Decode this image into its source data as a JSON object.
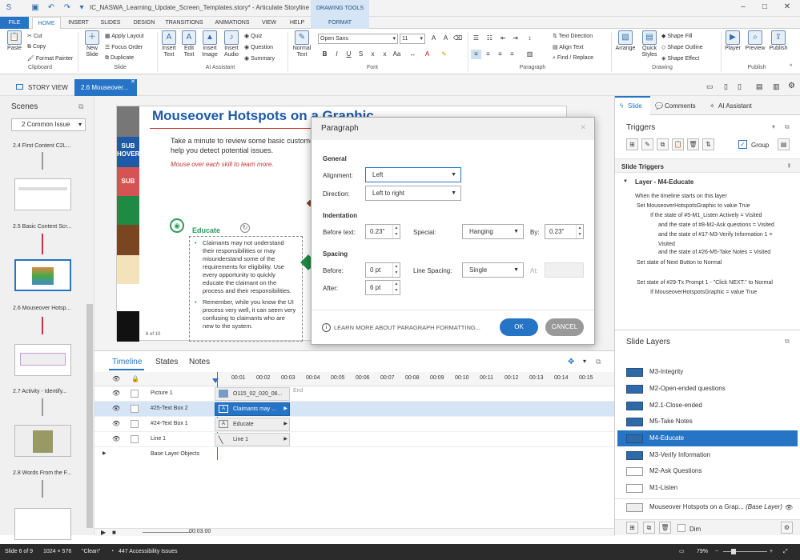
{
  "title": "IC_NASWA_Learning_Update_Screen_Templates.story* - Articulate Storyline x64",
  "contextual_tab": "DRAWING TOOLS",
  "tabs": [
    "FILE",
    "HOME",
    "INSERT",
    "SLIDES",
    "DESIGN",
    "TRANSITIONS",
    "ANIMATIONS",
    "VIEW",
    "HELP",
    "FORMAT"
  ],
  "ribbon": {
    "paste": "Paste",
    "cut": "Cut",
    "copy": "Copy",
    "format_painter": "Format Painter",
    "clipboard": "Clipboard",
    "new_slide": "New Slide",
    "apply_layout": "Apply Layout",
    "focus_order": "Focus Order",
    "duplicate": "Duplicate",
    "slide_group": "Slide",
    "insert_text": "Insert Text",
    "edit_text": "Edit Text",
    "insert_image": "Insert Image",
    "insert_audio": "Insert Audio",
    "quiz": "Quiz",
    "question": "Question",
    "summary": "Summary",
    "ai_assistant": "AI Assistant",
    "normal_text": "Normal Text",
    "font_name": "Open Sans",
    "font_size": "11",
    "font_group": "Font",
    "text_direction": "Text Direction",
    "align_text": "Align Text",
    "find_replace": "Find / Replace",
    "paragraph_group": "Paragraph",
    "arrange": "Arrange",
    "quick_styles": "Quick Styles",
    "shape_fill": "Shape Fill",
    "shape_outline": "Shape Outline",
    "shape_effect": "Shape Effect",
    "drawing_group": "Drawing",
    "player": "Player",
    "preview": "Preview",
    "publish": "Publish",
    "publish_group": "Publish"
  },
  "doc_tabs": {
    "story_view": "STORY VIEW",
    "current": "2.6 Mouseover..."
  },
  "scenes": {
    "title": "Scenes",
    "dropdown": "2 Common Issue",
    "labels": [
      "2.4 First Content C2L...",
      "2.5 Basic Content Scr...",
      "2.6 Mouseover Hotsp...",
      "2.7 Activity - Identify...",
      "2.8 Words From the F..."
    ]
  },
  "slide": {
    "heading": "Mouseover Hotspots on a Graphic",
    "intro": "Take a minute to review some basic customer",
    "intro2": "help you detect potential issues.",
    "instruction": "Mouse over each skill to learn more.",
    "sub1": "SUB",
    "hover": "HOVER",
    "sub2": "SUB",
    "educate": "Educate",
    "footer": "6 of 10",
    "bullets": [
      "Claimants may not understand their responsibilities or may misunderstand some of the requirements for eligibility. Use every opportunity to quickly educate the claimant on the process and their responsibilities.",
      "Remember, while you know the UI process very well, it can seem very confusing to claimants who are new to the system."
    ]
  },
  "dialog": {
    "title": "Paragraph",
    "general": "General",
    "alignment_label": "Alignment:",
    "alignment": "Left",
    "direction_label": "Direction:",
    "direction": "Left to right",
    "indentation": "Indentation",
    "before_text_label": "Before text:",
    "before_text": "0.23\"",
    "special_label": "Special:",
    "special": "Hanging",
    "by_label": "By:",
    "by": "0.23\"",
    "spacing": "Spacing",
    "before_label": "Before:",
    "before": "0 pt",
    "line_spacing_label": "Line Spacing:",
    "line_spacing": "Single",
    "at_label": "At:",
    "after_label": "After:",
    "after": "6 pt",
    "learn_more": "LEARN MORE ABOUT PARAGRAPH FORMATTING...",
    "ok": "OK",
    "cancel": "CANCEL"
  },
  "timeline": {
    "tabs": [
      "Timeline",
      "States",
      "Notes"
    ],
    "ticks": [
      "00:01",
      "00:02",
      "00:03",
      "00:04",
      "00:05",
      "00:06",
      "00:07",
      "00:08",
      "00:09",
      "00:10",
      "00:11",
      "00:12",
      "00:13",
      "00:14",
      "00:15"
    ],
    "end": "End",
    "time": "00:03.00",
    "rows": [
      {
        "name": "Picture 1",
        "bar": "O115_02_020_06..."
      },
      {
        "name": "#25-Text Box 2",
        "bar": "Claimants may ..."
      },
      {
        "name": "#24-Text Box 1",
        "bar": "Educate"
      },
      {
        "name": "Line 1",
        "bar": "Line 1"
      }
    ],
    "base": "Base Layer Objects"
  },
  "right": {
    "tabs": [
      "Slide",
      "Comments",
      "AI Assistant"
    ],
    "triggers": "Triggers",
    "group": "Group",
    "slide_triggers": "Slide Triggers",
    "layer_head": "Layer - M4-Educate",
    "lines": [
      "When the timeline starts on this layer",
      "Set MouseoverHotspotsGraphic to value True",
      "If the state of #5-M1_Listen Actively = Visited",
      "and the state of #8-M2-Ask questions = Visited",
      "and the state of #17-M3-Verify Information 1 =",
      "Visited",
      "and the state of #26-M5-Take Notes = Visited",
      "Set state of Next Button to Normal",
      "Set state of #29-Tx Prompt 1 - \"Click NEXT.\" to Normal",
      "If MouseoverHotspotsGraphic = value True"
    ],
    "slide_layers": "Slide Layers",
    "layers": [
      "M3-Integrity",
      "M2-Open-ended questions",
      "M2.1-Close-ended",
      "M5-Take Notes",
      "M4-Educate",
      "M3-Verify Information",
      "M2-Ask Questions",
      "M1-Listen"
    ],
    "base_layer": "Mouseover Hotspots on a Grap...",
    "base_layer_tag": "(Base Layer)",
    "dim": "Dim"
  },
  "status": {
    "slide": "Slide 6 of 9",
    "size": "1024 × 576",
    "clean": "\"Clean\"",
    "access": "447 Accessibility Issues",
    "zoom": "79%"
  }
}
